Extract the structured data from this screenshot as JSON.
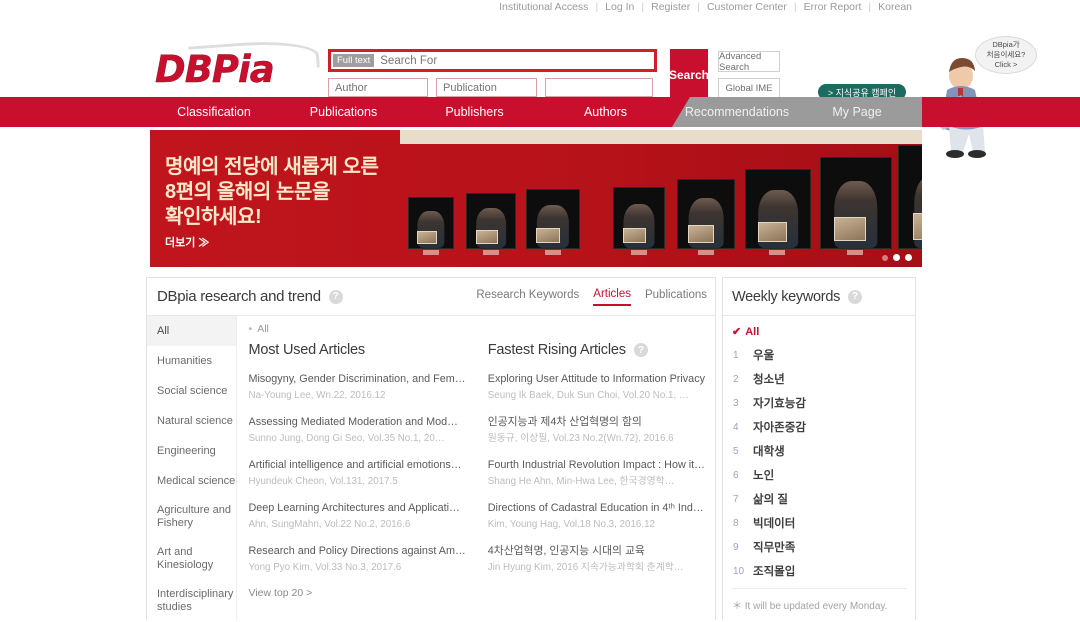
{
  "utility_bar": {
    "links": [
      "Institutional Access",
      "Log In",
      "Register",
      "Customer Center",
      "Error Report",
      "Korean"
    ],
    "separator": "|"
  },
  "header": {
    "logo_text": "DBPia",
    "search": {
      "fulltext_tag": "Full text",
      "main_placeholder": "Search For",
      "main_value": "",
      "author_placeholder": "Author",
      "publication_placeholder": "Publication",
      "third_placeholder": "",
      "search_button": "Search",
      "advanced_search": "Advanced Search",
      "global_ime": "Global IME"
    },
    "campaign_button": "> 지식공유 캠페인",
    "mascot_bubble_line1": "DBpia가",
    "mascot_bubble_line2": "처음이세요?",
    "mascot_bubble_line3": "Click >"
  },
  "main_nav": {
    "items": [
      {
        "label": "Classification",
        "group": "primary"
      },
      {
        "label": "Publications",
        "group": "primary"
      },
      {
        "label": "Publishers",
        "group": "primary"
      },
      {
        "label": "Authors",
        "group": "primary"
      },
      {
        "label": "Recommendations",
        "group": "secondary"
      },
      {
        "label": "My Page",
        "group": "secondary"
      }
    ]
  },
  "banner": {
    "line1": "명예의 전당에 새롭게 오른",
    "line2": "8편의 올해의 논문을",
    "line3": "확인하세요!",
    "more_link": "더보기 ≫",
    "slide_count": 3,
    "active_slide": 2
  },
  "research_panel": {
    "title": "DBpia research and trend",
    "help_icon": "?",
    "tabs": [
      {
        "label": "Research Keywords",
        "active": false
      },
      {
        "label": "Articles",
        "active": true
      },
      {
        "label": "Publications",
        "active": false
      }
    ],
    "categories": [
      {
        "label": "All",
        "active": true
      },
      {
        "label": "Humanities",
        "active": false
      },
      {
        "label": "Social science",
        "active": false
      },
      {
        "label": "Natural science",
        "active": false
      },
      {
        "label": "Engineering",
        "active": false
      },
      {
        "label": "Medical science",
        "active": false
      },
      {
        "label": "Agriculture and Fishery",
        "active": false
      },
      {
        "label": "Art and Kinesiology",
        "active": false
      },
      {
        "label": "Interdisciplinary studies",
        "active": false
      }
    ],
    "breadcrumb_all": "All",
    "most_used": {
      "title": "Most Used Articles",
      "articles": [
        {
          "title": "Misogyny, Gender Discrimination, and Fem…",
          "meta": "Na-Young Lee, Wn.22, 2016.12"
        },
        {
          "title": "Assessing Mediated Moderation and Mod…",
          "meta": "Sunno Jung, Dong Gi Seo, Vol.35 No.1, 20…"
        },
        {
          "title": "Artificial intelligence and artificial emotions…",
          "meta": "Hyundeuk Cheon, Vol.131, 2017.5"
        },
        {
          "title": "Deep Learning Architectures and Applicati…",
          "meta": "Ahn, SungMahn, Vol.22 No.2, 2016.6"
        },
        {
          "title": "Research and Policy Directions against Am…",
          "meta": "Yong Pyo Kim, Vol.33 No.3, 2017.6"
        }
      ],
      "view_more": "View top 20 >"
    },
    "fastest_rising": {
      "title": "Fastest Rising Articles",
      "help_icon": "?",
      "articles": [
        {
          "title": "Exploring User Attitude to Information Privacy",
          "meta": "Seung Ik Baek, Duk Sun Choi, Vol.20 No.1, …"
        },
        {
          "title": "인공지능과 제4차 산업혁명의 함의",
          "meta": "원동규, 이상필, Vol.23 No.2(Wn.72), 2016.6"
        },
        {
          "title": "Fourth Industrial Revolution Impact : How it…",
          "meta": "Shang He Ahn, Min-Hwa Lee, 한국경영학…"
        },
        {
          "title": "Directions of Cadastral Education in 4ᵗʰ Ind…",
          "meta": "Kim, Young Hag, Vol.18 No.3, 2016.12"
        },
        {
          "title": "4차산업혁명, 인공지능 시대의 교육",
          "meta": "Jin Hyung Kim, 2016 지속가능과학회 춘계학…"
        }
      ]
    }
  },
  "weekly_keywords": {
    "title": "Weekly keywords",
    "help_icon": "?",
    "all_label": "All",
    "check_glyph": "✔",
    "items": [
      {
        "rank": "1",
        "word": "우울"
      },
      {
        "rank": "2",
        "word": "청소년"
      },
      {
        "rank": "3",
        "word": "자기효능감"
      },
      {
        "rank": "4",
        "word": "자아존중감"
      },
      {
        "rank": "5",
        "word": "대학생"
      },
      {
        "rank": "6",
        "word": "노인"
      },
      {
        "rank": "7",
        "word": "삶의 질"
      },
      {
        "rank": "8",
        "word": "빅데이터"
      },
      {
        "rank": "9",
        "word": "직무만족"
      },
      {
        "rank": "10",
        "word": "조직몰입"
      }
    ],
    "note": "＊ It will be updated every Monday."
  },
  "colors": {
    "brand_red": "#c8102e",
    "banner_red": "#b9121a",
    "nav_gray": "#9b9b9b",
    "campaign_green": "#1d6b5e"
  }
}
